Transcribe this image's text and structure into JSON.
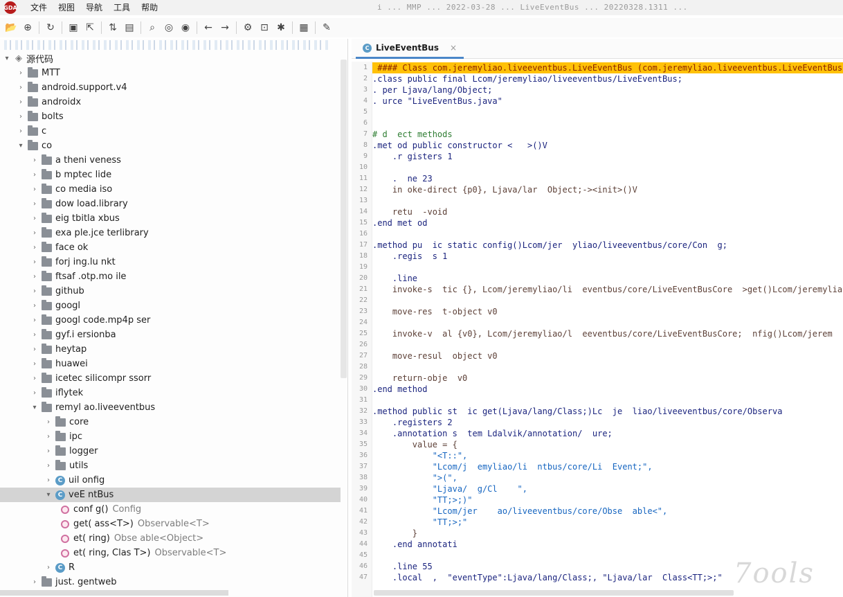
{
  "app": {
    "logo_text": "GDA"
  },
  "menu": [
    "文件",
    "视图",
    "导航",
    "工具",
    "帮助"
  ],
  "window_title": "i ... MMP ... 2022-03-28 ... LiveEventBus ... 20220328.1311 ...",
  "toolbar": {
    "buttons": [
      "open-icon",
      "add-icon",
      "refresh-icon",
      "save-icon",
      "export-icon",
      "sync-icon",
      "tree-icon",
      "search-icon",
      "find-class-icon",
      "find-method-icon",
      "back-icon",
      "forward-icon",
      "decompile-icon",
      "inspect-icon",
      "debug-icon",
      "log-icon",
      "settings-icon"
    ]
  },
  "tree": {
    "root_label": "源代码",
    "items": [
      {
        "label": "MTT",
        "kind": "folder",
        "indent": 1
      },
      {
        "label": "android.support.v4",
        "kind": "folder",
        "indent": 1
      },
      {
        "label": "androidx",
        "kind": "folder",
        "indent": 1
      },
      {
        "label": "bolts",
        "kind": "folder",
        "indent": 1
      },
      {
        "label": "c",
        "kind": "folder",
        "indent": 1
      },
      {
        "label": "co",
        "kind": "folder",
        "indent": 1,
        "expanded": true
      },
      {
        "label": "a  theni    veness",
        "kind": "folder",
        "indent": 2
      },
      {
        "label": "b  mptec    lide",
        "kind": "folder",
        "indent": 2
      },
      {
        "label": "co  media   iso",
        "kind": "folder",
        "indent": 2
      },
      {
        "label": "dow  load.library",
        "kind": "folder",
        "indent": 2
      },
      {
        "label": "eig  tbitla  xbus",
        "kind": "folder",
        "indent": 2
      },
      {
        "label": "exa  ple.jce  terlibrary",
        "kind": "folder",
        "indent": 2
      },
      {
        "label": "face  ok",
        "kind": "folder",
        "indent": 2
      },
      {
        "label": "forj  ing.lu  nkt",
        "kind": "folder",
        "indent": 2
      },
      {
        "label": "ftsaf  .otp.mo  ile",
        "kind": "folder",
        "indent": 2
      },
      {
        "label": "github",
        "kind": "folder",
        "indent": 2
      },
      {
        "label": "googl",
        "kind": "folder",
        "indent": 2
      },
      {
        "label": "googl  code.mp4p  ser",
        "kind": "folder",
        "indent": 2
      },
      {
        "label": "gyf.i  ersionba",
        "kind": "folder",
        "indent": 2
      },
      {
        "label": "heytap",
        "kind": "folder",
        "indent": 2
      },
      {
        "label": "huawei",
        "kind": "folder",
        "indent": 2
      },
      {
        "label": "icetec  silicompr  ssorr",
        "kind": "folder",
        "indent": 2
      },
      {
        "label": "iflytek",
        "kind": "folder",
        "indent": 2
      },
      {
        "label": "  remyl  ao.liveeventbus",
        "kind": "folder",
        "indent": 2,
        "expanded": true
      },
      {
        "label": "core",
        "kind": "folder",
        "indent": 3
      },
      {
        "label": "ipc",
        "kind": "folder",
        "indent": 3
      },
      {
        "label": "logger",
        "kind": "folder",
        "indent": 3
      },
      {
        "label": "utils",
        "kind": "folder",
        "indent": 3
      },
      {
        "label": "  uil  onfig",
        "kind": "class",
        "indent": 3
      },
      {
        "label": "  veE  ntBus",
        "kind": "class",
        "indent": 3,
        "expanded": true,
        "selected": true
      },
      {
        "label": "conf  g()",
        "sig": "Config",
        "kind": "method",
        "indent": 4
      },
      {
        "label": "get(  ass<T>)",
        "sig": "Observable<T>",
        "kind": "method",
        "indent": 4
      },
      {
        "label": "  et(  ring)",
        "sig": "Obse  able<Object>",
        "kind": "method",
        "indent": 4
      },
      {
        "label": "  et(  ring, Clas  T>)",
        "sig": "Observable<T>",
        "kind": "method",
        "indent": 4
      },
      {
        "label": "R",
        "kind": "class",
        "indent": 3
      },
      {
        "label": "just.  gentweb",
        "kind": "folder",
        "indent": 2
      }
    ]
  },
  "editor": {
    "tab_title": "LiveEventBus",
    "tab_close": "×",
    "lines": [
      {
        "n": "1",
        "text": " #### Class com.jeremyliao.liveeventbus.LiveEventBus (com.jeremyliao.liveeventbus.LiveEventBus)",
        "style": "hl"
      },
      {
        "n": "2",
        "text": ".class public final Lcom/jeremyliao/liveeventbus/LiveEventBus;",
        "style": "dir"
      },
      {
        "n": "3",
        "text": ". per Ljava/lang/Object;",
        "style": "dir"
      },
      {
        "n": "4",
        "text": ". urce \"LiveEventBus.java\"",
        "style": "dir"
      },
      {
        "n": "5",
        "text": "",
        "style": "dir"
      },
      {
        "n": "6",
        "text": "",
        "style": "dir"
      },
      {
        "n": "7",
        "text": "# d  ect methods",
        "style": "comment"
      },
      {
        "n": "8",
        "text": ".met od public constructor <   >()V",
        "style": "dir"
      },
      {
        "n": "9",
        "text": "    .r gisters 1",
        "style": "dir"
      },
      {
        "n": "10",
        "text": "",
        "style": "dir"
      },
      {
        "n": "11",
        "text": "    .  ne 23",
        "style": "dir"
      },
      {
        "n": "12",
        "text": "    in oke-direct {p0}, Ljava/lar  Object;-><init>()V",
        "style": "op"
      },
      {
        "n": "13",
        "text": "",
        "style": "dir"
      },
      {
        "n": "14",
        "text": "    retu  -void",
        "style": "op"
      },
      {
        "n": "15",
        "text": ".end met od",
        "style": "dir"
      },
      {
        "n": "16",
        "text": "",
        "style": "dir"
      },
      {
        "n": "17",
        "text": ".method pu  ic static config()Lcom/jer  yliao/liveeventbus/core/Con  g;",
        "style": "dir"
      },
      {
        "n": "18",
        "text": "    .regis  s 1",
        "style": "dir"
      },
      {
        "n": "19",
        "text": "",
        "style": "dir"
      },
      {
        "n": "20",
        "text": "    .line",
        "style": "dir"
      },
      {
        "n": "21",
        "text": "    invoke-s  tic {}, Lcom/jeremyliao/li  eventbus/core/LiveEventBusCore  >get()Lcom/jeremyliao/l",
        "style": "op"
      },
      {
        "n": "22",
        "text": "",
        "style": "dir"
      },
      {
        "n": "23",
        "text": "    move-res  t-object v0",
        "style": "op"
      },
      {
        "n": "24",
        "text": "",
        "style": "dir"
      },
      {
        "n": "25",
        "text": "    invoke-v  al {v0}, Lcom/jeremyliao/l  eeventbus/core/LiveEventBusCore;  nfig()Lcom/jerem",
        "style": "op"
      },
      {
        "n": "26",
        "text": "",
        "style": "dir"
      },
      {
        "n": "27",
        "text": "    move-resul  object v0",
        "style": "op"
      },
      {
        "n": "28",
        "text": "",
        "style": "dir"
      },
      {
        "n": "29",
        "text": "    return-obje  v0",
        "style": "op"
      },
      {
        "n": "30",
        "text": ".end method",
        "style": "dir"
      },
      {
        "n": "31",
        "text": "",
        "style": "dir"
      },
      {
        "n": "32",
        "text": ".method public st  ic get(Ljava/lang/Class;)Lc  je  liao/liveeventbus/core/Observa",
        "style": "dir"
      },
      {
        "n": "33",
        "text": "    .registers 2",
        "style": "dir"
      },
      {
        "n": "34",
        "text": "    .annotation s  tem Ldalvik/annotation/  ure;",
        "style": "dir"
      },
      {
        "n": "35",
        "text": "        value = {",
        "style": "op"
      },
      {
        "n": "36",
        "text": "            \"<T::\",",
        "style": "str"
      },
      {
        "n": "37",
        "text": "            \"Lcom/j  emyliao/li  ntbus/core/Li  Event;\",",
        "style": "str"
      },
      {
        "n": "38",
        "text": "            \">(\",",
        "style": "str"
      },
      {
        "n": "39",
        "text": "            \"Ljava/  g/Cl    \",",
        "style": "str"
      },
      {
        "n": "40",
        "text": "            \"TT;>;)\"",
        "style": "str"
      },
      {
        "n": "41",
        "text": "            \"Lcom/jer    ao/liveeventbus/core/Obse  able<\",",
        "style": "str"
      },
      {
        "n": "42",
        "text": "            \"TT;>;\"",
        "style": "str"
      },
      {
        "n": "43",
        "text": "        }",
        "style": "op"
      },
      {
        "n": "44",
        "text": "    .end annotati",
        "style": "dir"
      },
      {
        "n": "45",
        "text": "",
        "style": "dir"
      },
      {
        "n": "46",
        "text": "    .line 55",
        "style": "dir"
      },
      {
        "n": "47",
        "text": "    .local  ,  \"eventType\":Ljava/lang/Class;, \"Ljava/lar  Class<TT;>;\"",
        "style": "dir"
      }
    ]
  },
  "watermark": "7ools"
}
